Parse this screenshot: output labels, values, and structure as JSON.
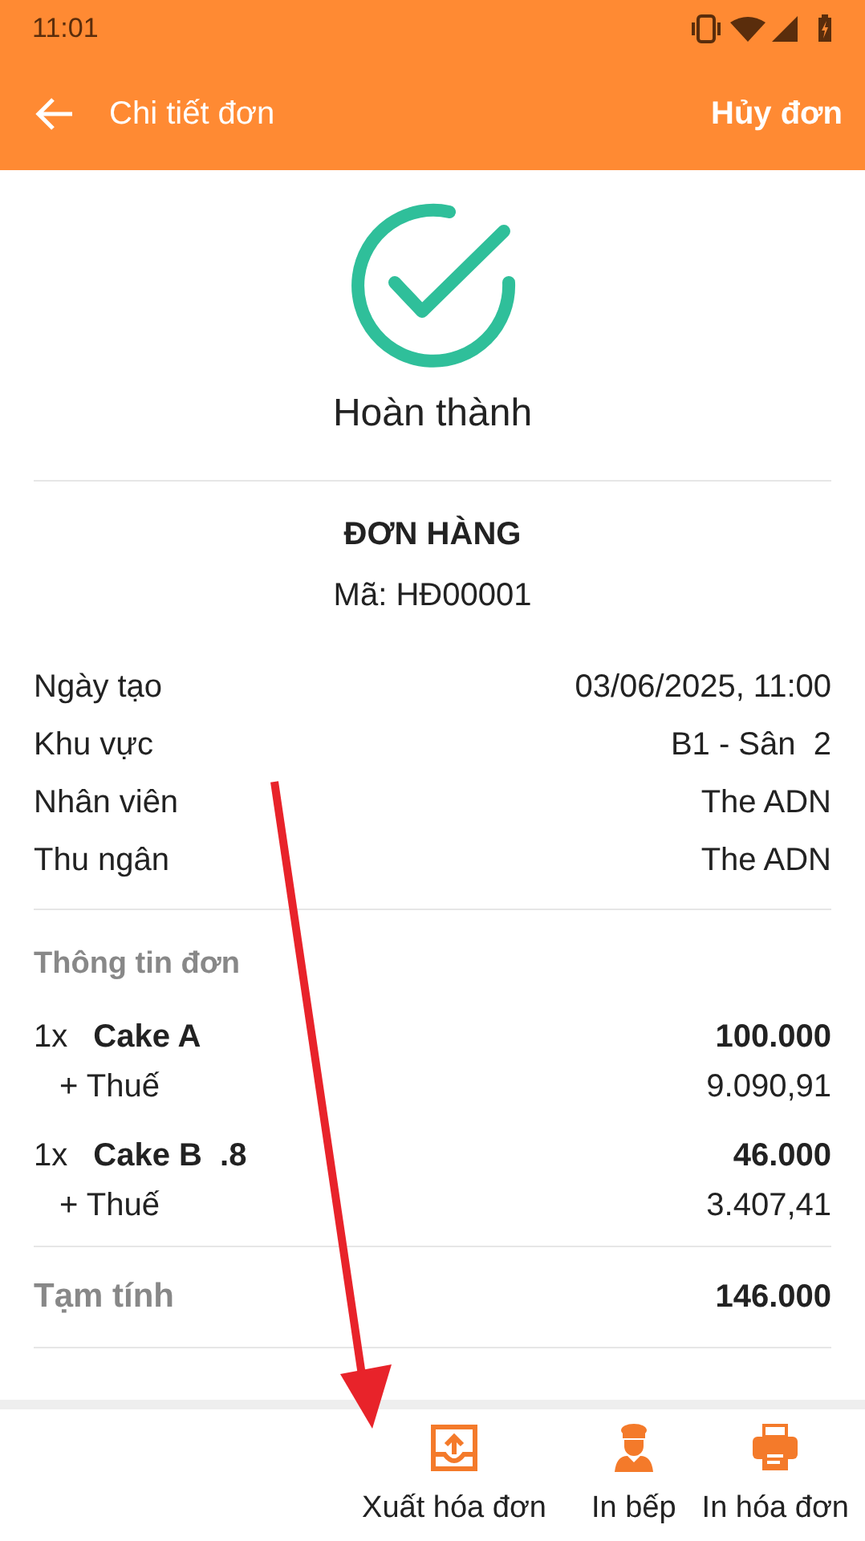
{
  "status_bar": {
    "time": "11:01"
  },
  "app_bar": {
    "title": "Chi tiết đơn",
    "action": "Hủy đơn"
  },
  "status": {
    "label": "Hoàn thành",
    "kind": "done"
  },
  "order": {
    "heading": "ĐƠN HÀNG",
    "code": "Mã: HĐ00001"
  },
  "info": [
    {
      "label": "Ngày tạo",
      "value": "03/06/2025, 11:00"
    },
    {
      "label": "Khu vực",
      "value": "B1 - Sân  2"
    },
    {
      "label": "Nhân viên",
      "value": "The ADN"
    },
    {
      "label": "Thu ngân",
      "value": "The ADN"
    }
  ],
  "items_heading": "Thông tin đơn",
  "items": [
    {
      "qty": "1x",
      "name": "Cake A",
      "price": "100.000",
      "tax_label": "+ Thuế",
      "tax": "9.090,91"
    },
    {
      "qty": "1x",
      "name": "Cake B  .8",
      "price": "46.000",
      "tax_label": "+ Thuế",
      "tax": "3.407,41"
    }
  ],
  "subtotal": {
    "label": "Tạm tính",
    "value": "146.000"
  },
  "bottom_actions": [
    {
      "kind": "export",
      "label": "Xuất hóa đơn"
    },
    {
      "kind": "chef",
      "label": "In bếp"
    },
    {
      "kind": "printer",
      "label": "In hóa đơn"
    }
  ]
}
